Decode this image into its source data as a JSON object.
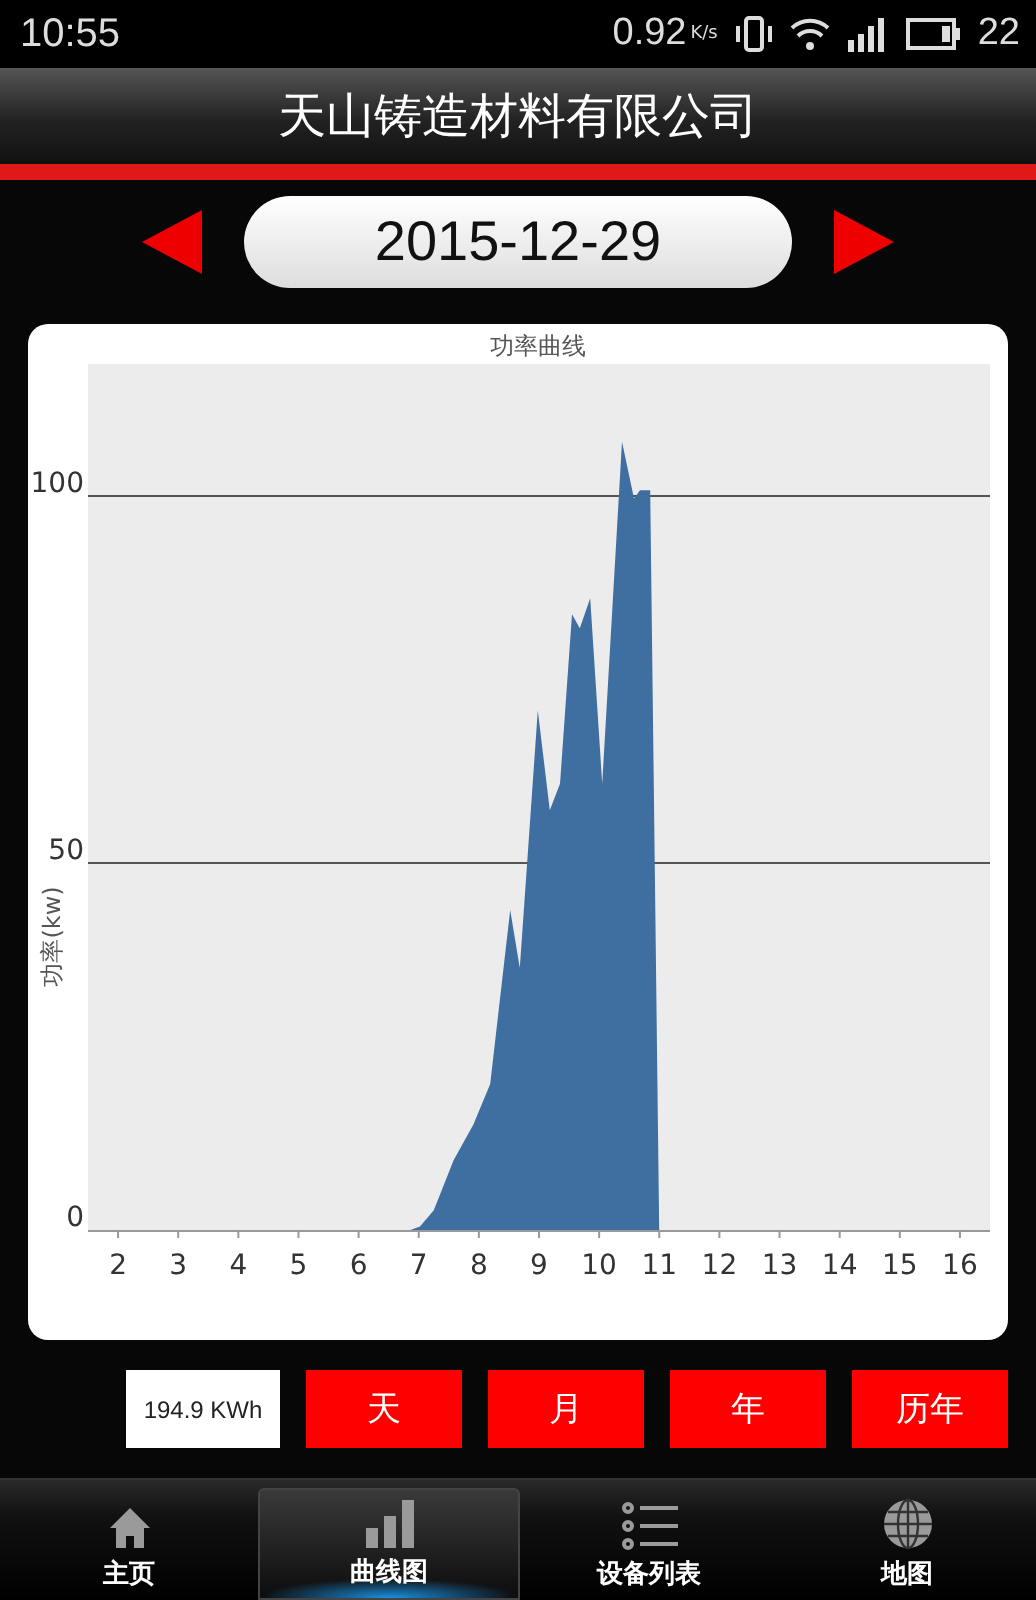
{
  "status_bar": {
    "time": "10:55",
    "net_speed": "0.92",
    "net_unit": "K/s",
    "battery": "22"
  },
  "header": {
    "title": "天山铸造材料有限公司"
  },
  "date_nav": {
    "date": "2015-12-29"
  },
  "chart": {
    "chart_data": {
      "type": "area",
      "title": "功率曲线",
      "ylabel": "功率(kw)",
      "x": [
        1.5,
        6.86,
        7.02,
        7.25,
        7.58,
        7.91,
        8.19,
        8.52,
        8.68,
        8.98,
        9.18,
        9.35,
        9.55,
        9.68,
        9.85,
        10.05,
        10.38,
        10.58,
        10.68,
        10.85,
        11.0
      ],
      "series": [
        {
          "color": "#3f6fa0",
          "values": [
            0,
            0,
            0.5,
            2.7,
            9.5,
            14.4,
            19.9,
            43.6,
            35.7,
            70.8,
            57.2,
            60.8,
            83.9,
            82,
            86.1,
            60.8,
            107.4,
            99.7,
            100.8,
            100.8,
            0
          ]
        }
      ],
      "xlim": [
        1.5,
        16.5
      ],
      "ylim": [
        0,
        118
      ],
      "xticks": [
        2,
        3,
        4,
        5,
        6,
        7,
        8,
        9,
        10,
        11,
        12,
        13,
        14,
        15,
        16
      ],
      "yticks": [
        0,
        50,
        100
      ]
    }
  },
  "summary": {
    "energy": "194.9 KWh",
    "periods": [
      {
        "label": "天"
      },
      {
        "label": "月"
      },
      {
        "label": "年"
      },
      {
        "label": "历年"
      }
    ]
  },
  "tabs": [
    {
      "label": "主页",
      "kind": "home",
      "selected": false
    },
    {
      "label": "曲线图",
      "kind": "chart",
      "selected": true
    },
    {
      "label": "设备列表",
      "kind": "list",
      "selected": false
    },
    {
      "label": "地图",
      "kind": "globe",
      "selected": false
    }
  ]
}
